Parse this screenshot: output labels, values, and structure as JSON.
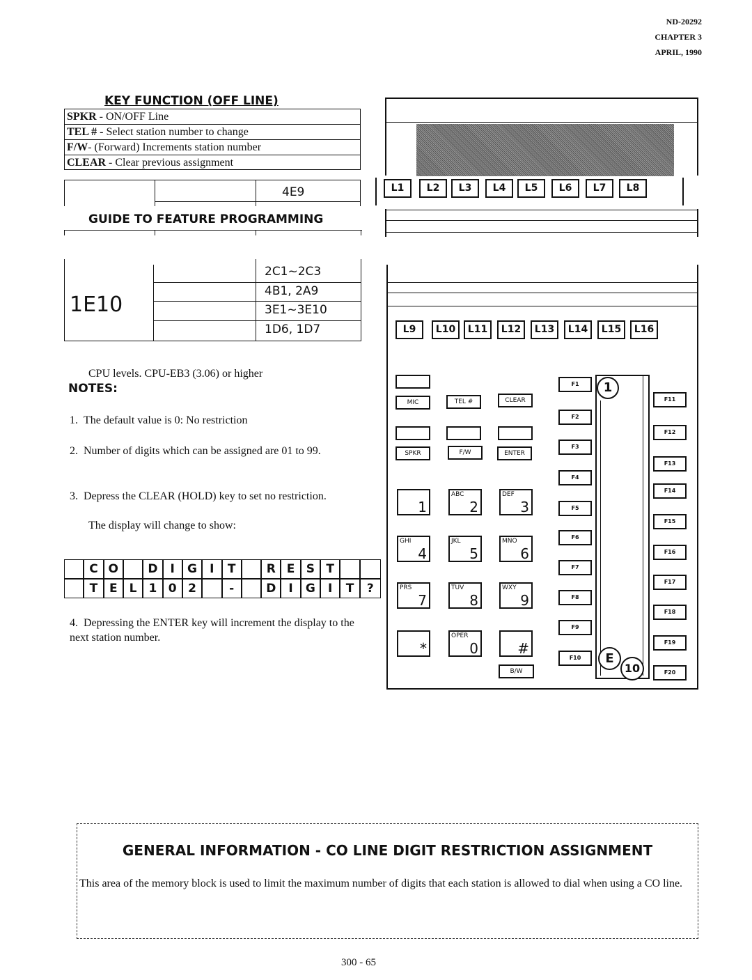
{
  "header": {
    "doc": "ND-20292",
    "chapter": "CHAPTER 3",
    "date": "APRIL, 1990"
  },
  "key_function": {
    "title": "KEY FUNCTION (OFF LINE)",
    "rows": [
      {
        "key": "SPKR",
        "desc": " - ON/OFF Line"
      },
      {
        "key": "TEL #",
        "desc": " - Select station number to change"
      },
      {
        "key": "F/W",
        "desc": "- (Forward) Increments station number"
      },
      {
        "key": "CLEAR",
        "desc": " - Clear previous assignment"
      }
    ]
  },
  "partial_table": {
    "value": "4E9"
  },
  "guide": {
    "title": "GUIDE TO FEATURE PROGRAMMING",
    "block": "1E10",
    "entries": [
      "2C1~2C3",
      "4B1, 2A9",
      "3E1~3E10",
      "1D6, 1D7"
    ]
  },
  "cpu_note": "CPU levels. CPU-EB3 (3.06) or higher",
  "notes": {
    "title": "NOTES:",
    "items": [
      "1.  The default value is 0: No restriction",
      "2.  Number of digits which can be assigned are 01 to 99.",
      "3.  Depress the CLEAR (HOLD) key to set no restriction.",
      "The display will change to show:",
      "4.  Depressing the ENTER key will increment the display to the next station number."
    ]
  },
  "display": {
    "row1": [
      "",
      " C",
      "O",
      "",
      "D",
      "I",
      "G",
      "I",
      "T",
      "",
      "R",
      "E",
      "S",
      "T",
      "",
      ""
    ],
    "row2": [
      "",
      "T",
      "E",
      "L",
      "1",
      "0",
      "2",
      "",
      "-",
      "",
      "D",
      "I",
      "G",
      "I",
      "T",
      "?",
      "?"
    ]
  },
  "phone": {
    "line_keys_top": [
      "L1",
      "L2",
      "L3",
      "L4",
      "L5",
      "L6",
      "L7",
      "L8"
    ],
    "line_keys_bottom": [
      "L9",
      "L10",
      "L11",
      "L12",
      "L13",
      "L14",
      "L15",
      "L16"
    ],
    "func_keys": [
      "MIC",
      "TEL #",
      "CLEAR",
      "SPKR",
      "F/W",
      "ENTER",
      "B/W"
    ],
    "dial": [
      {
        "l": "",
        "n": "1"
      },
      {
        "l": "ABC",
        "n": "2"
      },
      {
        "l": "DEF",
        "n": "3"
      },
      {
        "l": "GHI",
        "n": "4"
      },
      {
        "l": "JKL",
        "n": "5"
      },
      {
        "l": "MNO",
        "n": "6"
      },
      {
        "l": "PRS",
        "n": "7"
      },
      {
        "l": "TUV",
        "n": "8"
      },
      {
        "l": "WXY",
        "n": "9"
      },
      {
        "l": "",
        "n": "*"
      },
      {
        "l": "OPER",
        "n": "0"
      },
      {
        "l": "",
        "n": "#"
      }
    ],
    "f_left": [
      "F1",
      "F2",
      "F3",
      "F4",
      "F5",
      "F6",
      "F7",
      "F8",
      "F9",
      "F10"
    ],
    "f_right": [
      "F11",
      "F12",
      "F13",
      "F14",
      "F15",
      "F16",
      "F17",
      "F18",
      "F19",
      "F20"
    ],
    "markers": [
      "1",
      "E",
      "10"
    ]
  },
  "general": {
    "title": "GENERAL INFORMATION  -  CO LINE DIGIT RESTRICTION ASSIGNMENT",
    "body": "This area of the memory block is used to  limit the maximum number of digits  that each station is allowed to dial when using a CO line."
  },
  "footer": {
    "page": "300 - 65"
  }
}
